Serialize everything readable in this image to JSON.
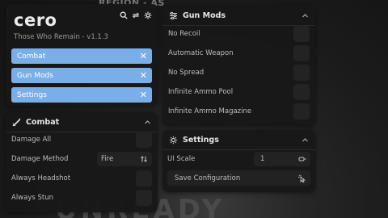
{
  "background": {
    "top_text": "REGION - AS",
    "bottom_text": "UNREADY"
  },
  "window": {
    "brand": "cero",
    "subtitle": "Those Who Remain - v1.1.3",
    "icons": [
      "search-icon",
      "refresh-icon",
      "settings-gear-icon"
    ],
    "tabs": [
      {
        "label": "Combat",
        "close": "✕"
      },
      {
        "label": "Gun Mods",
        "close": "✕"
      },
      {
        "label": "Settings",
        "close": "✕"
      }
    ],
    "accent_color": "#7aaee8"
  },
  "combat": {
    "title": "Combat",
    "icon": "sword-icon",
    "rows": [
      {
        "label": "Damage All"
      },
      {
        "label": "Damage Method",
        "value": "Fire"
      },
      {
        "label": "Always Headshot"
      },
      {
        "label": "Always Stun"
      }
    ]
  },
  "gun_mods": {
    "title": "Gun Mods",
    "icon": "sliders-icon",
    "rows": [
      {
        "label": "No Recoil"
      },
      {
        "label": "Automatic Weapon"
      },
      {
        "label": "No Spread"
      },
      {
        "label": "Infinite Ammo Pool"
      },
      {
        "label": "Infinite Ammo Magazine"
      }
    ]
  },
  "settings": {
    "title": "Settings",
    "icon": "gear-icon",
    "ui_scale_label": "UI Scale",
    "ui_scale_value": "1",
    "save_label": "Save Configuration"
  }
}
